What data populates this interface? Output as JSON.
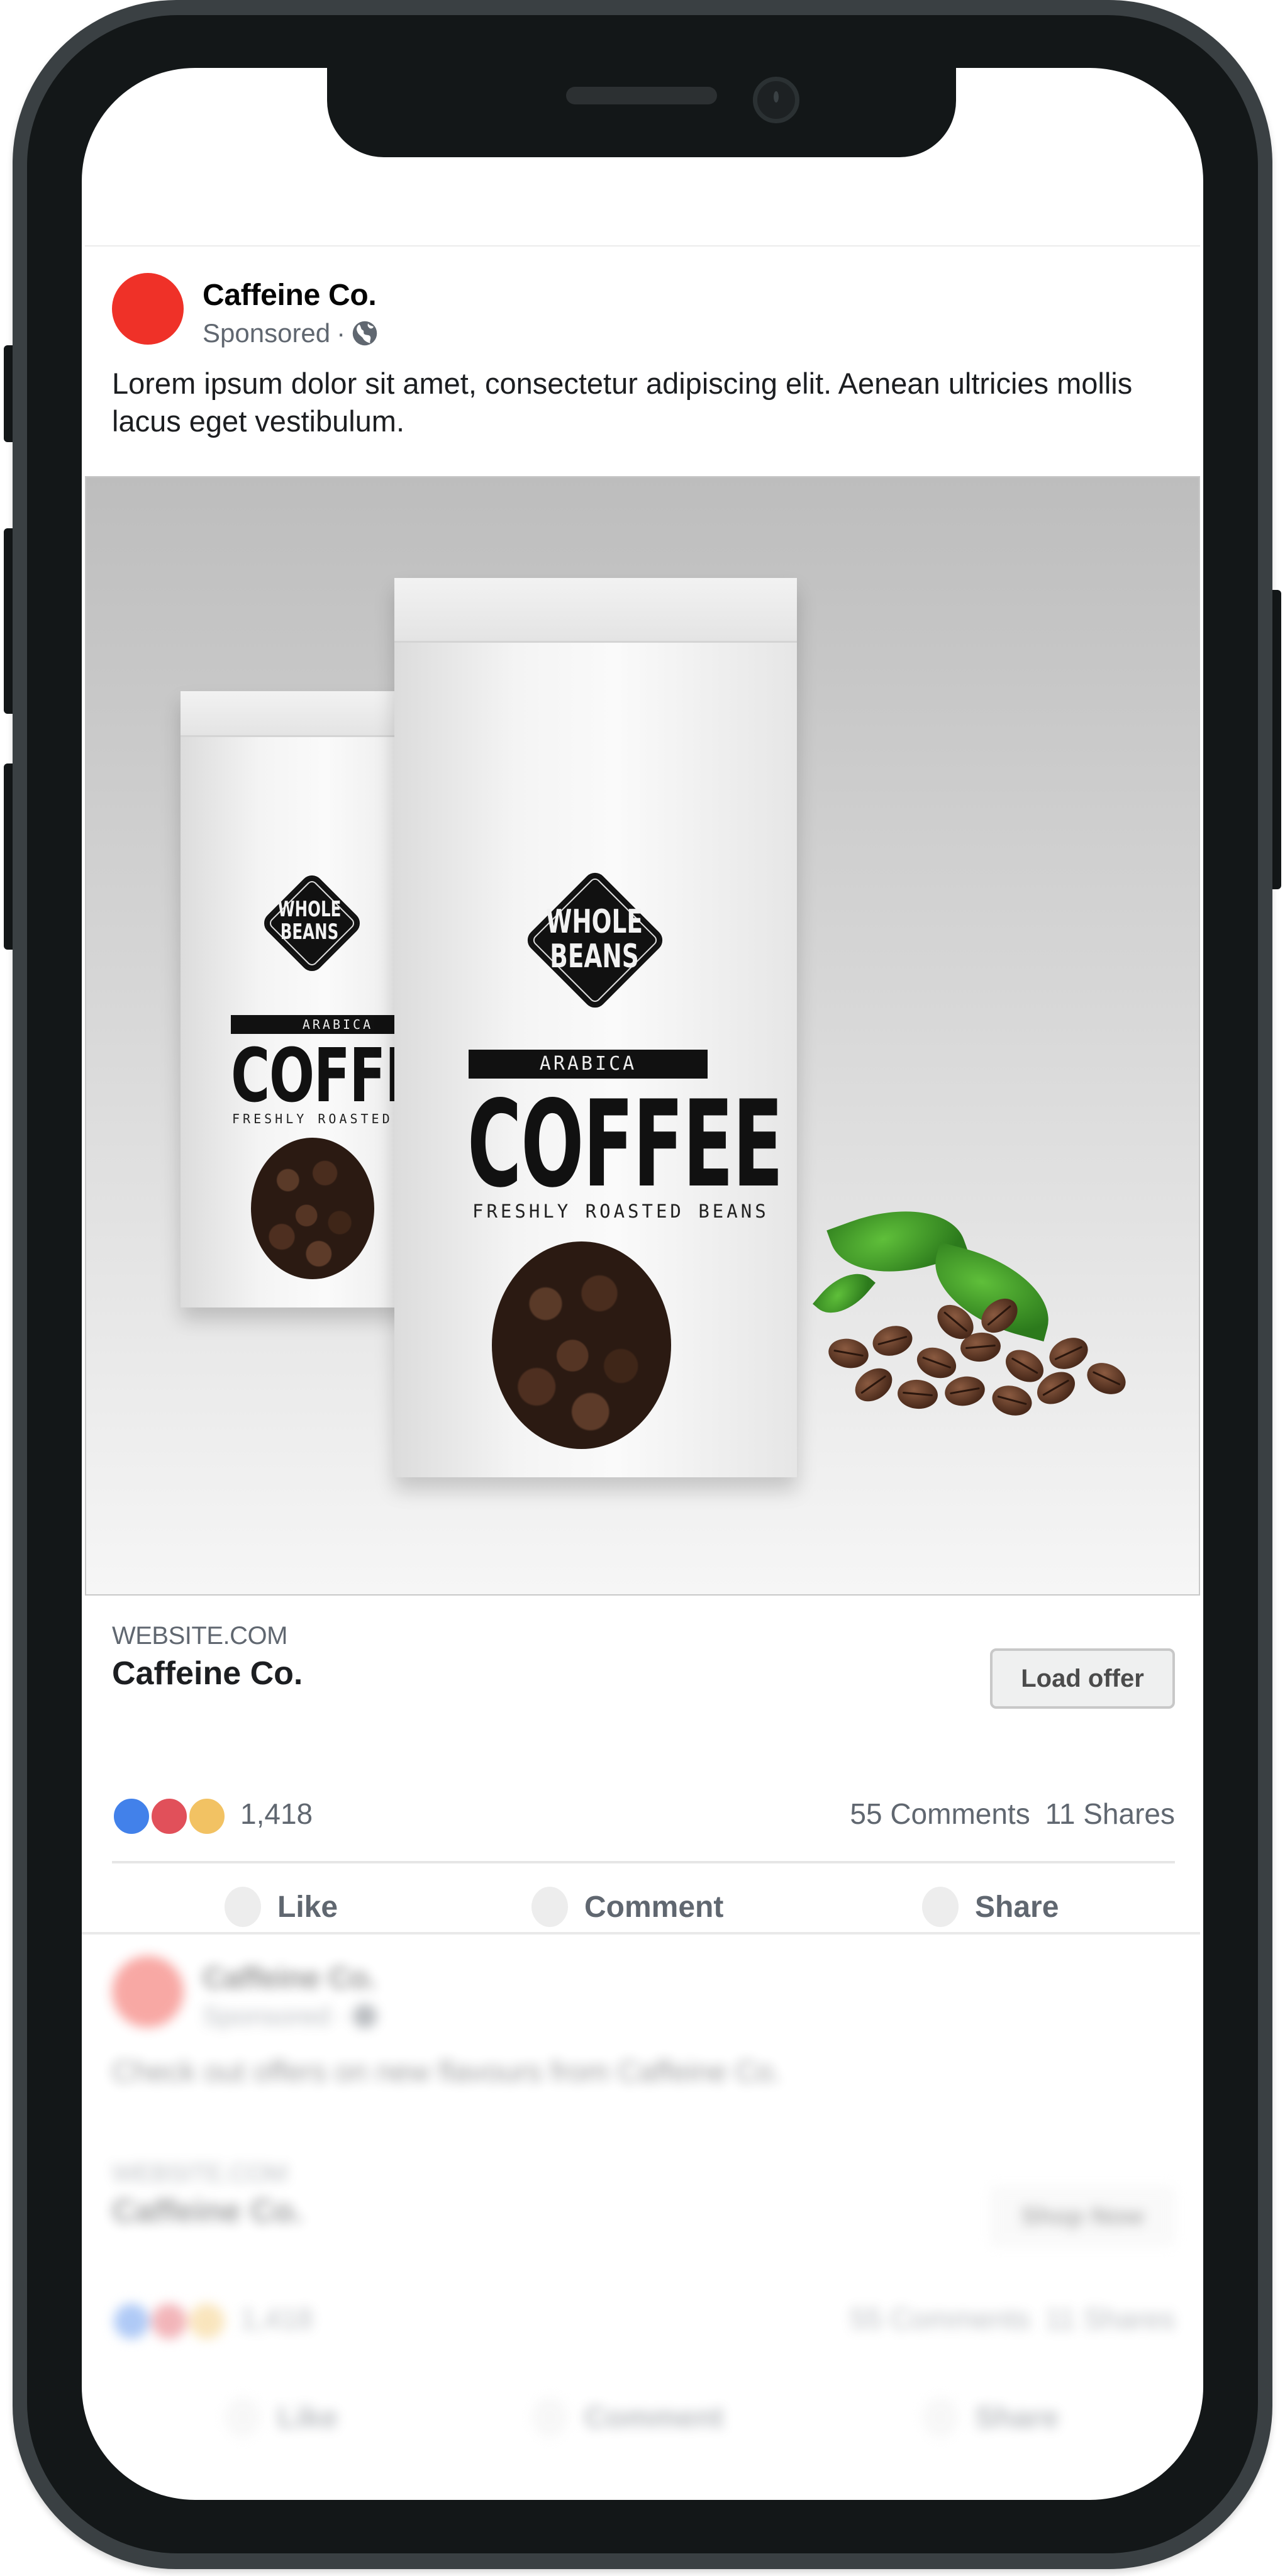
{
  "post": {
    "page_name": "Caffeine Co.",
    "sponsored_label": "Sponsored",
    "meta_separator": "·",
    "audience_icon": "globe-icon",
    "body_text": "Lorem ipsum dolor sit amet, consectetur adipiscing elit. Aenean ultricies mollis lacus eget vestibulum.",
    "avatar_color": "#EF3128",
    "image": {
      "description": "Two white coffee bags with coffee beans and leaves",
      "badge_line1": "WHOLE",
      "badge_line2": "BEANS",
      "band_label": "ARABICA",
      "product_word": "COFFEE",
      "tagline": "FRESHLY ROASTED BEANS"
    },
    "link": {
      "domain": "WEBSITE.COM",
      "title": "Caffeine Co.",
      "cta_label": "Load offer"
    },
    "stats": {
      "reaction_colors": [
        "#4281EA",
        "#E1505A",
        "#F2C263"
      ],
      "reaction_count": "1,418",
      "comments": "55 Comments",
      "shares": "11 Shares"
    },
    "actions": [
      {
        "label": "Like",
        "icon": "like-icon"
      },
      {
        "label": "Comment",
        "icon": "comment-icon"
      },
      {
        "label": "Share",
        "icon": "share-icon"
      }
    ]
  },
  "next_post": {
    "page_name": "Caffeine Co.",
    "sponsored_label": "Sponsored",
    "meta_separator": "·",
    "body_text": "Check out offers on new flavours from Caffeine Co.",
    "link": {
      "domain": "WEBSITE.COM",
      "title": "Caffeine Co.",
      "cta_label": "Shop Now"
    },
    "stats": {
      "reaction_count": "1,418",
      "comments": "55 Comments",
      "shares": "11 Shares"
    },
    "actions": [
      {
        "label": "Like"
      },
      {
        "label": "Comment"
      },
      {
        "label": "Share"
      }
    ]
  }
}
